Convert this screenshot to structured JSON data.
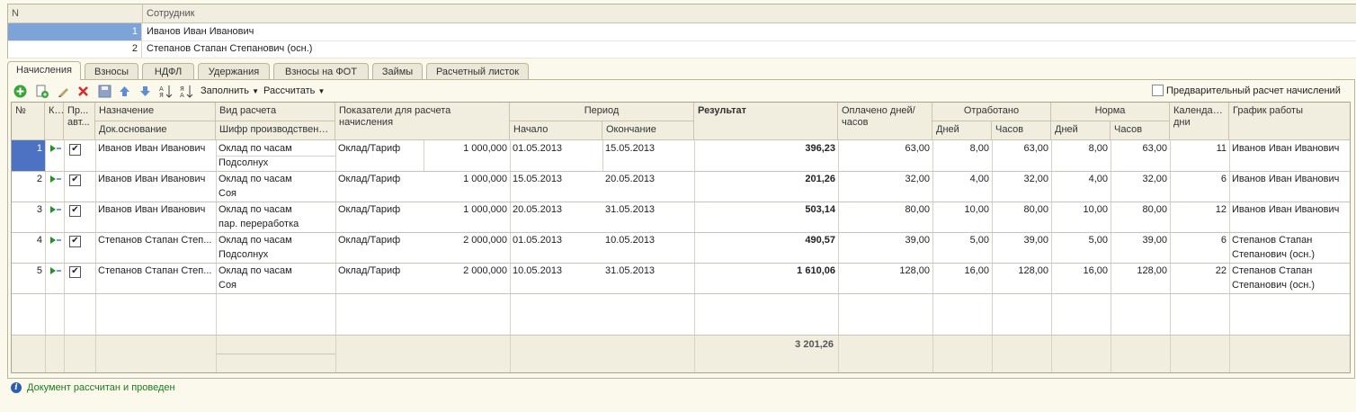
{
  "employees": {
    "columns": {
      "n": "N",
      "employee": "Сотрудник"
    },
    "rows": [
      {
        "n": "1",
        "name": "Иванов Иван Иванович",
        "selected": true
      },
      {
        "n": "2",
        "name": "Степанов Стапан Степанович  (осн.)",
        "selected": false
      }
    ]
  },
  "tabs": [
    "Начисления",
    "Взносы",
    "НДФЛ",
    "Удержания",
    "Взносы на ФОТ",
    "Займы",
    "Расчетный листок"
  ],
  "active_tab": "Начисления",
  "toolbar": {
    "icons": [
      "add-icon",
      "copy-icon",
      "edit-icon",
      "delete-icon",
      "save-icon",
      "move-up-icon",
      "move-down-icon",
      "sort-asc-icon",
      "sort-desc-icon"
    ],
    "fill_label": "Заполнить",
    "calc_label": "Рассчитать",
    "precalc_label": "Предварительный расчет начислений",
    "precalc_checked": false
  },
  "grid": {
    "headers": {
      "num": "№",
      "k": "К...",
      "pr": "Пр... авт...",
      "purpose": "Назначение",
      "doc_base": "Док.основание",
      "calc_type": "Вид расчета",
      "prod_code": "Шифр производственн...",
      "indicators": "Показатели для расчета начисления",
      "period": "Период",
      "start": "Начало",
      "end": "Окончание",
      "result": "Результат",
      "paid": "Оплачено дней/часов",
      "worked": "Отработано",
      "norm": "Норма",
      "days": "Дней",
      "hours": "Часов",
      "calendar": "Календар... дни",
      "schedule": "График работы"
    },
    "rows": [
      {
        "num": "1",
        "auto": true,
        "purpose": "Иванов Иван Иванович",
        "calc_type": "Оклад по часам",
        "prod_code": "Подсолнух",
        "indicator": "Оклад/Тариф",
        "indicator_value": "1 000,000",
        "start": "01.05.2013",
        "end": "15.05.2013",
        "result": "396,23",
        "paid": "63,00",
        "w_days": "8,00",
        "w_hours": "63,00",
        "n_days": "8,00",
        "n_hours": "63,00",
        "calendar": "11",
        "schedule": "Иванов Иван Иванович"
      },
      {
        "num": "2",
        "auto": true,
        "purpose": "Иванов Иван Иванович",
        "calc_type": "Оклад по часам",
        "prod_code": "Соя",
        "indicator": "Оклад/Тариф",
        "indicator_value": "1 000,000",
        "start": "15.05.2013",
        "end": "20.05.2013",
        "result": "201,26",
        "paid": "32,00",
        "w_days": "4,00",
        "w_hours": "32,00",
        "n_days": "4,00",
        "n_hours": "32,00",
        "calendar": "6",
        "schedule": "Иванов Иван Иванович"
      },
      {
        "num": "3",
        "auto": true,
        "purpose": "Иванов Иван Иванович",
        "calc_type": "Оклад по часам",
        "prod_code": "пар. переработка",
        "indicator": "Оклад/Тариф",
        "indicator_value": "1 000,000",
        "start": "20.05.2013",
        "end": "31.05.2013",
        "result": "503,14",
        "paid": "80,00",
        "w_days": "10,00",
        "w_hours": "80,00",
        "n_days": "10,00",
        "n_hours": "80,00",
        "calendar": "12",
        "schedule": "Иванов Иван Иванович"
      },
      {
        "num": "4",
        "auto": true,
        "purpose": "Степанов Стапан Степ...",
        "calc_type": "Оклад по часам",
        "prod_code": "Подсолнух",
        "indicator": "Оклад/Тариф",
        "indicator_value": "2 000,000",
        "start": "01.05.2013",
        "end": "10.05.2013",
        "result": "490,57",
        "paid": "39,00",
        "w_days": "5,00",
        "w_hours": "39,00",
        "n_days": "5,00",
        "n_hours": "39,00",
        "calendar": "6",
        "schedule": "Степанов Стапан",
        "schedule2": "Степанович  (осн.)"
      },
      {
        "num": "5",
        "auto": true,
        "purpose": "Степанов Стапан Степ...",
        "calc_type": "Оклад по часам",
        "prod_code": "Соя",
        "indicator": "Оклад/Тариф",
        "indicator_value": "2 000,000",
        "start": "10.05.2013",
        "end": "31.05.2013",
        "result": "1 610,06",
        "paid": "128,00",
        "w_days": "16,00",
        "w_hours": "128,00",
        "n_days": "16,00",
        "n_hours": "128,00",
        "calendar": "22",
        "schedule": "Степанов Стапан",
        "schedule2": "Степанович  (осн.)"
      }
    ],
    "total_result": "3 201,26"
  },
  "status": {
    "text": "Документ рассчитан и проведен",
    "icon": "info-icon"
  }
}
